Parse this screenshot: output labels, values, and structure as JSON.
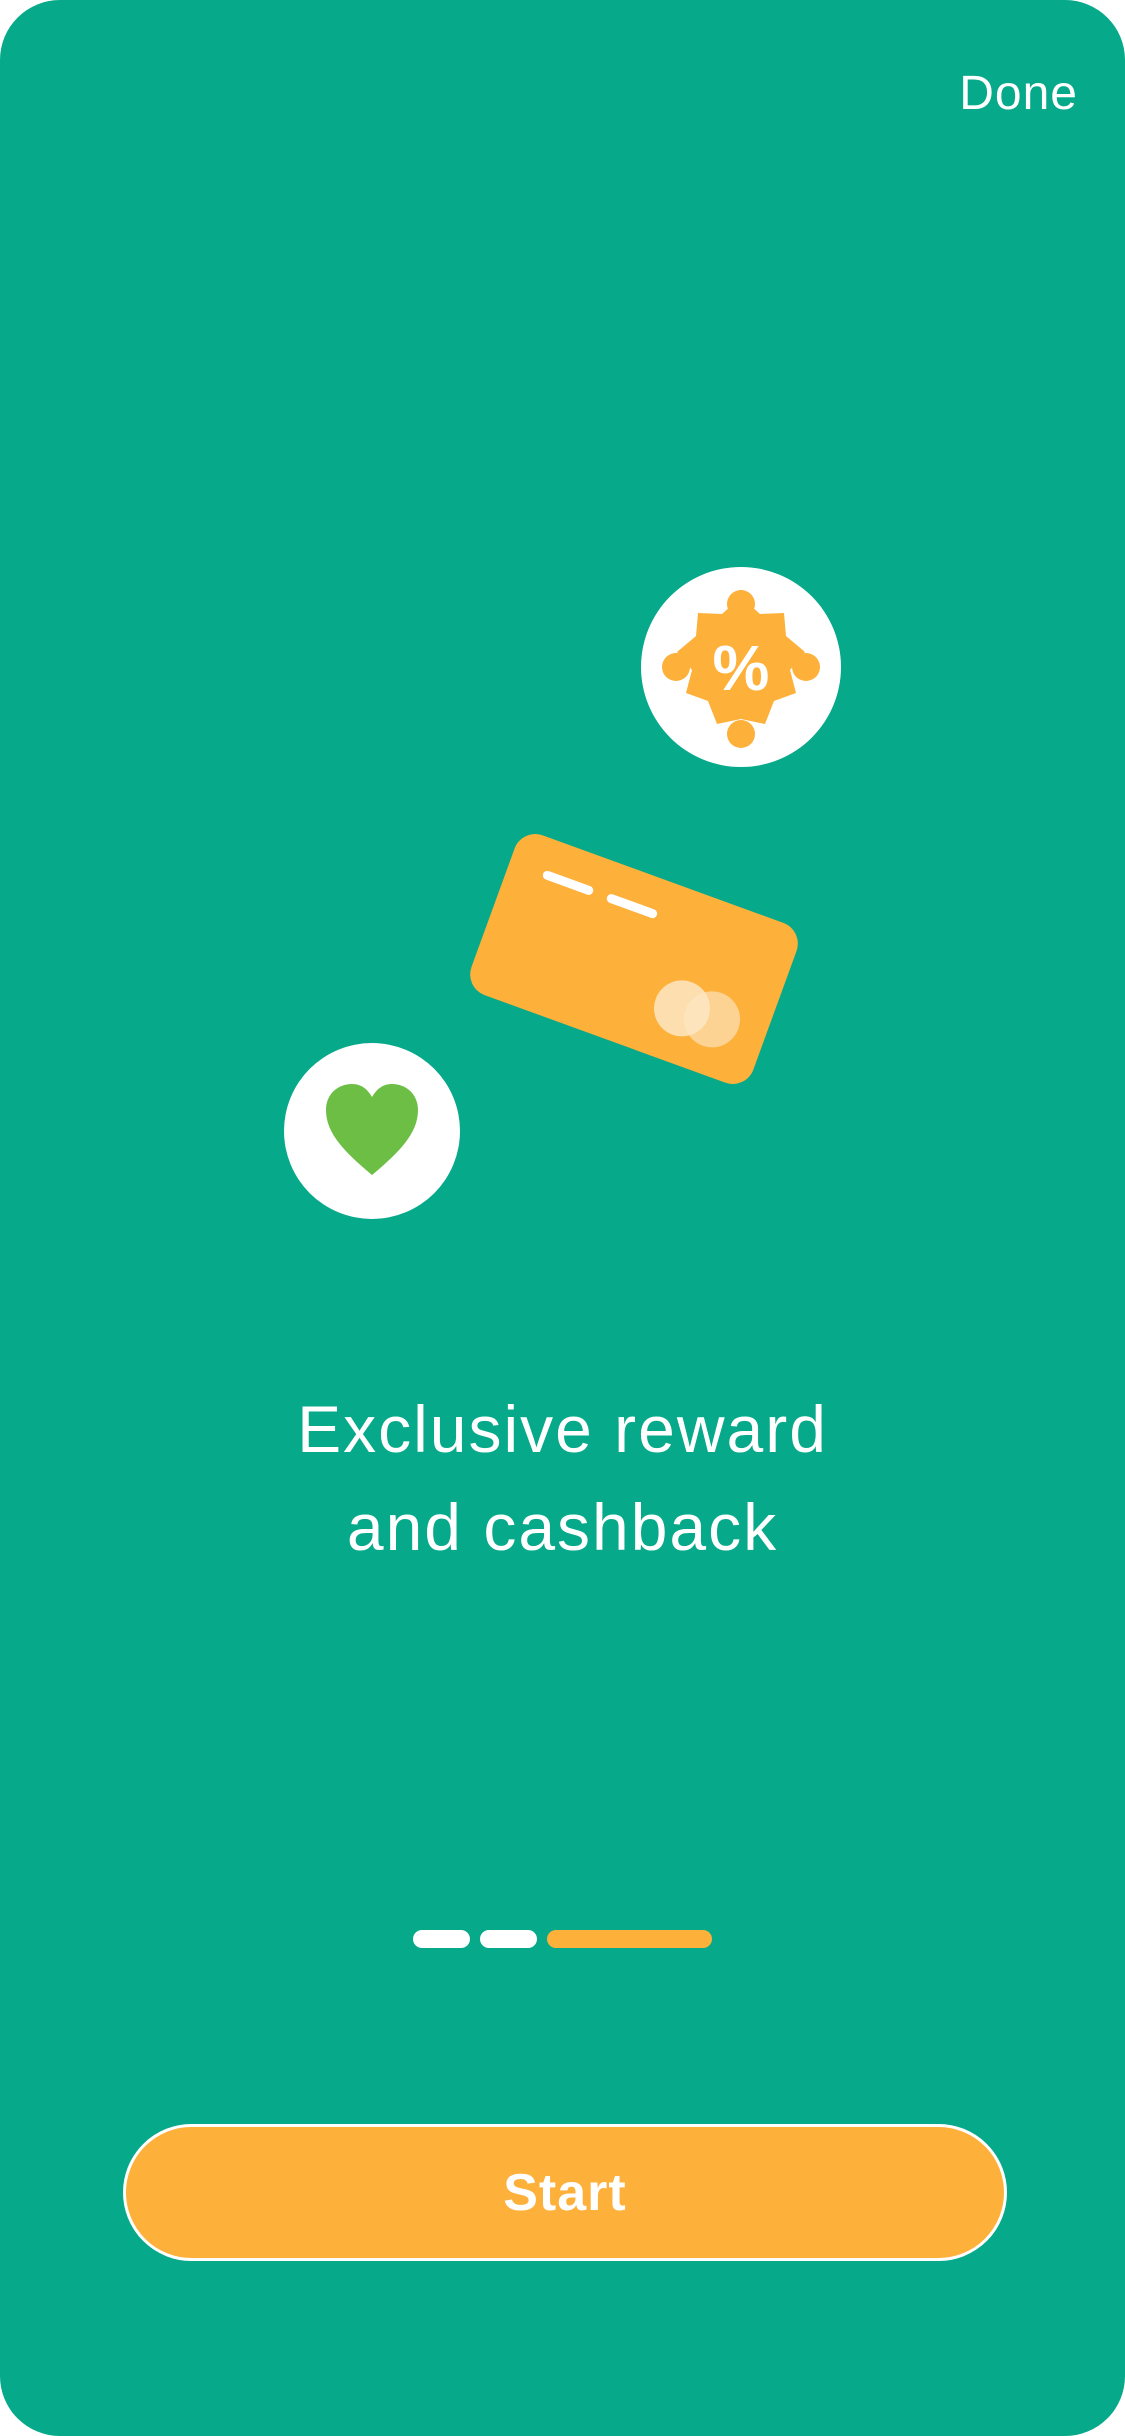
{
  "header": {
    "done_label": "Done"
  },
  "onboarding": {
    "headline_line1": "Exclusive reward",
    "headline_line2": "and cashback",
    "discount_symbol": "%",
    "pager": {
      "total_pages": 3,
      "current_page": 3
    }
  },
  "footer": {
    "start_label": "Start"
  },
  "colors": {
    "background": "#06A98A",
    "accent": "#FDB03A",
    "heart": "#6DBE45",
    "white": "#FFFFFF"
  },
  "icons": [
    "percent-badge-icon",
    "credit-card-icon",
    "heart-icon"
  ]
}
